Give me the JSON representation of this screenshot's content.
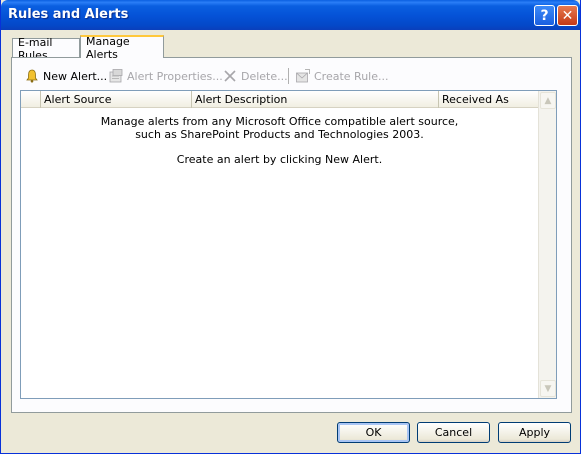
{
  "window": {
    "title": "Rules and Alerts"
  },
  "titlebar": {
    "help_glyph": "?",
    "close_glyph": "✕"
  },
  "tabs": [
    {
      "label": "E-mail Rules",
      "active": false
    },
    {
      "label": "Manage Alerts",
      "active": true
    }
  ],
  "toolbar": {
    "new_alert": {
      "label": "New Alert...",
      "icon": "bell-icon",
      "enabled": true
    },
    "alert_properties": {
      "label": "Alert Properties...",
      "icon": "properties-icon",
      "enabled": false
    },
    "delete": {
      "label": "Delete...",
      "icon": "delete-x-icon",
      "enabled": false
    },
    "create_rule": {
      "label": "Create Rule...",
      "icon": "create-rule-icon",
      "enabled": false
    }
  },
  "list": {
    "columns": [
      "",
      "Alert Source",
      "Alert Description",
      "Received As"
    ],
    "empty_message_line1": "Manage alerts from any Microsoft Office compatible alert source,",
    "empty_message_line2": "such as SharePoint Products and Technologies 2003.",
    "empty_message_line3": "Create an alert by clicking New Alert."
  },
  "buttons": {
    "ok": "OK",
    "cancel": "Cancel",
    "apply": "Apply"
  },
  "colors": {
    "titlebar": "#0553d8",
    "dialog_bg": "#ece9d8",
    "tab_highlight": "#ffc83c",
    "disabled_text": "#a7a6aa"
  }
}
